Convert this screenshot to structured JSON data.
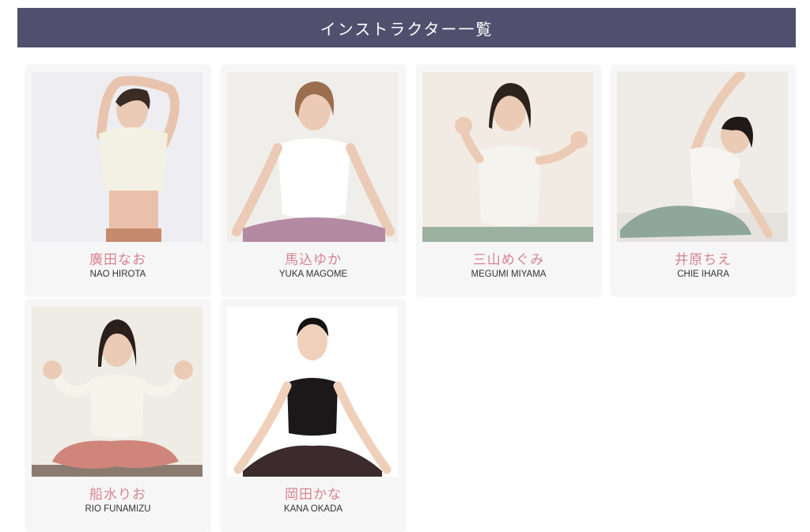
{
  "header": {
    "title": "インストラクター一覧"
  },
  "colors": {
    "header_bg": "#514f6e",
    "name_ja": "#d6848f",
    "card_bg": "#f7f6f6"
  },
  "instructors": [
    {
      "name_ja": "廣田なお",
      "name_en": "NAO HIROTA",
      "photo": "instructor-photo-white-top-stretch"
    },
    {
      "name_ja": "馬込ゆか",
      "name_en": "YUKA MAGOME",
      "photo": "instructor-photo-seated-white-top"
    },
    {
      "name_ja": "三山めぐみ",
      "name_en": "MEGUMI MIYAMA",
      "photo": "instructor-photo-waving-white-top"
    },
    {
      "name_ja": "井原ちえ",
      "name_en": "CHIE IHARA",
      "photo": "instructor-photo-side-stretch"
    },
    {
      "name_ja": "船水りお",
      "name_en": "RIO FUNAMIZU",
      "photo": "instructor-photo-seated-hands-up"
    },
    {
      "name_ja": "岡田かな",
      "name_en": "KANA OKADA",
      "photo": "instructor-photo-black-top-seated"
    }
  ]
}
